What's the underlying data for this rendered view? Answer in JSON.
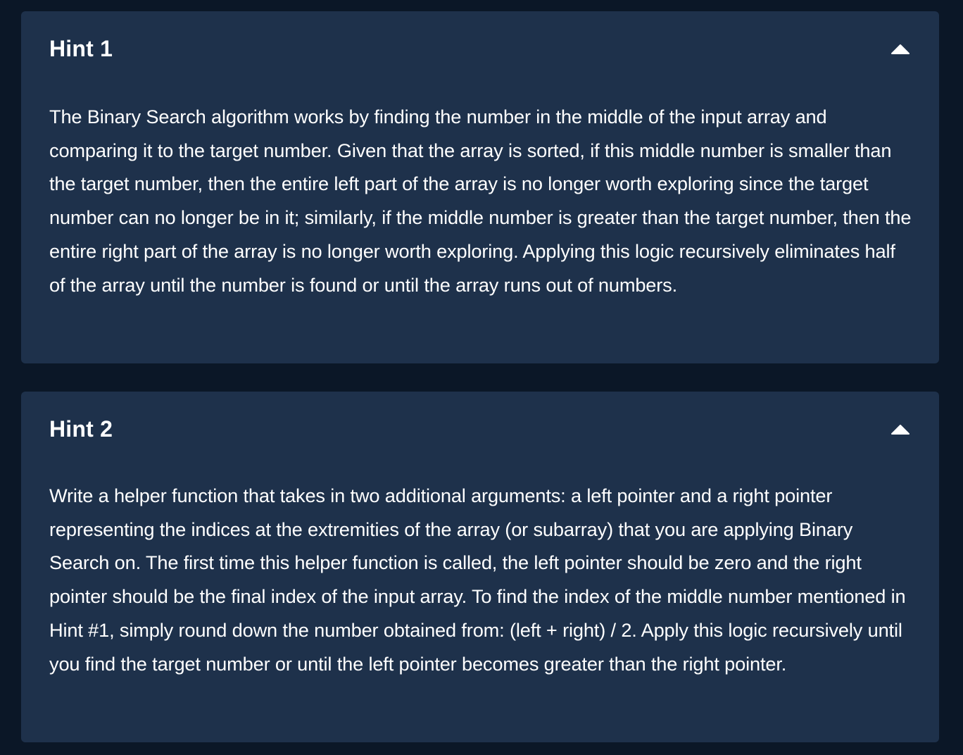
{
  "hints": [
    {
      "title": "Hint 1",
      "expanded": true,
      "toggle_icon": "chevron-up-icon",
      "body": "The Binary Search algorithm works by finding the number in the middle of the input array and comparing it to the target number. Given that the array is sorted, if this middle number is smaller than the target number, then the entire left part of the array is no longer worth exploring since the target number can no longer be in it; similarly, if the middle number is greater than the target number, then the entire right part of the array is no longer worth exploring. Applying this logic recursively eliminates half of the array until the number is found or until the array runs out of numbers."
    },
    {
      "title": "Hint 2",
      "expanded": true,
      "toggle_icon": "chevron-up-icon",
      "body": "Write a helper function that takes in two additional arguments: a left pointer and a right pointer representing the indices at the extremities of the array (or subarray) that you are applying Binary Search on. The first time this helper function is called, the left pointer should be zero and the right pointer should be the final index of the input array. To find the index of the middle number mentioned in Hint #1, simply round down the number obtained from: (left + right) / 2. Apply this logic recursively until you find the target number or until the left pointer becomes greater than the right pointer."
    }
  ],
  "colors": {
    "page_background": "#0b1727",
    "panel_background": "#1e314b",
    "text": "#ffffff"
  }
}
